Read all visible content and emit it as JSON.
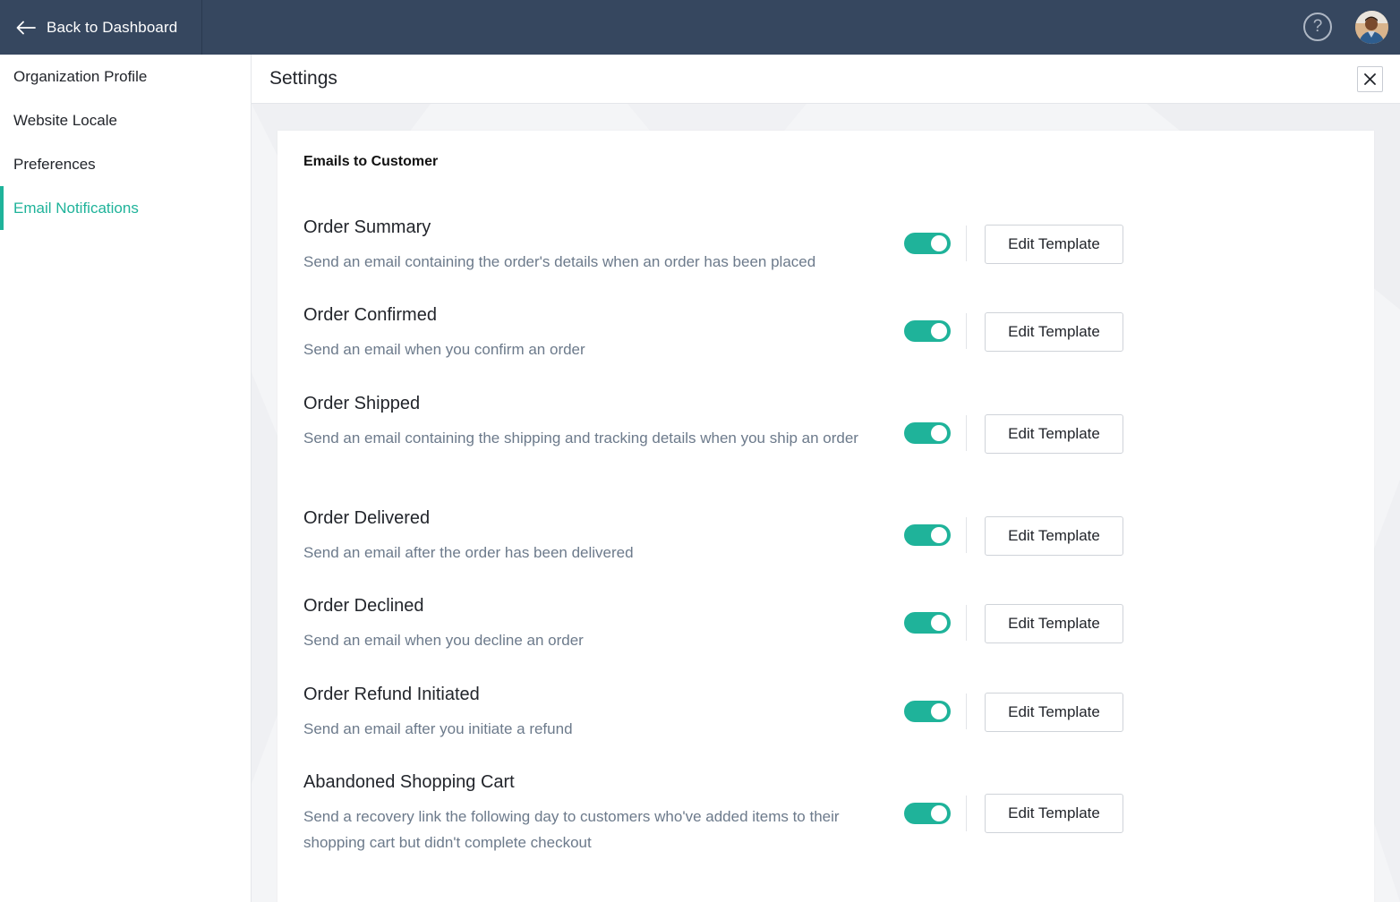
{
  "topbar": {
    "back_label": "Back to Dashboard",
    "help_symbol": "?",
    "bg_color": "#36475f"
  },
  "sidebar": {
    "items": [
      {
        "label": "Organization Profile",
        "active": false
      },
      {
        "label": "Website Locale",
        "active": false
      },
      {
        "label": "Preferences",
        "active": false
      },
      {
        "label": "Email Notifications",
        "active": true
      }
    ],
    "accent_color": "#1fb39a"
  },
  "settings": {
    "title": "Settings",
    "section_title": "Emails to Customer",
    "notifications": [
      {
        "title": "Order Summary",
        "description": "Send an email containing the order's details when an order has been placed",
        "enabled": true,
        "button_label": "Edit Template"
      },
      {
        "title": "Order Confirmed",
        "description": "Send an email when you confirm an order",
        "enabled": true,
        "button_label": "Edit Template"
      },
      {
        "title": "Order Shipped",
        "description": "Send an email containing the shipping and tracking details when you ship an order",
        "enabled": true,
        "button_label": "Edit Template"
      },
      {
        "title": "Order Delivered",
        "description": "Send an email after the order has been delivered",
        "enabled": true,
        "button_label": "Edit Template"
      },
      {
        "title": "Order Declined",
        "description": "Send an email when you decline an order",
        "enabled": true,
        "button_label": "Edit Template"
      },
      {
        "title": "Order Refund Initiated",
        "description": "Send an email after you initiate a refund",
        "enabled": true,
        "button_label": "Edit Template"
      },
      {
        "title": "Abandoned Shopping Cart",
        "description": "Send a recovery link the following day to customers who've added items to their shopping cart but didn't complete checkout",
        "enabled": true,
        "button_label": "Edit Template"
      }
    ]
  }
}
